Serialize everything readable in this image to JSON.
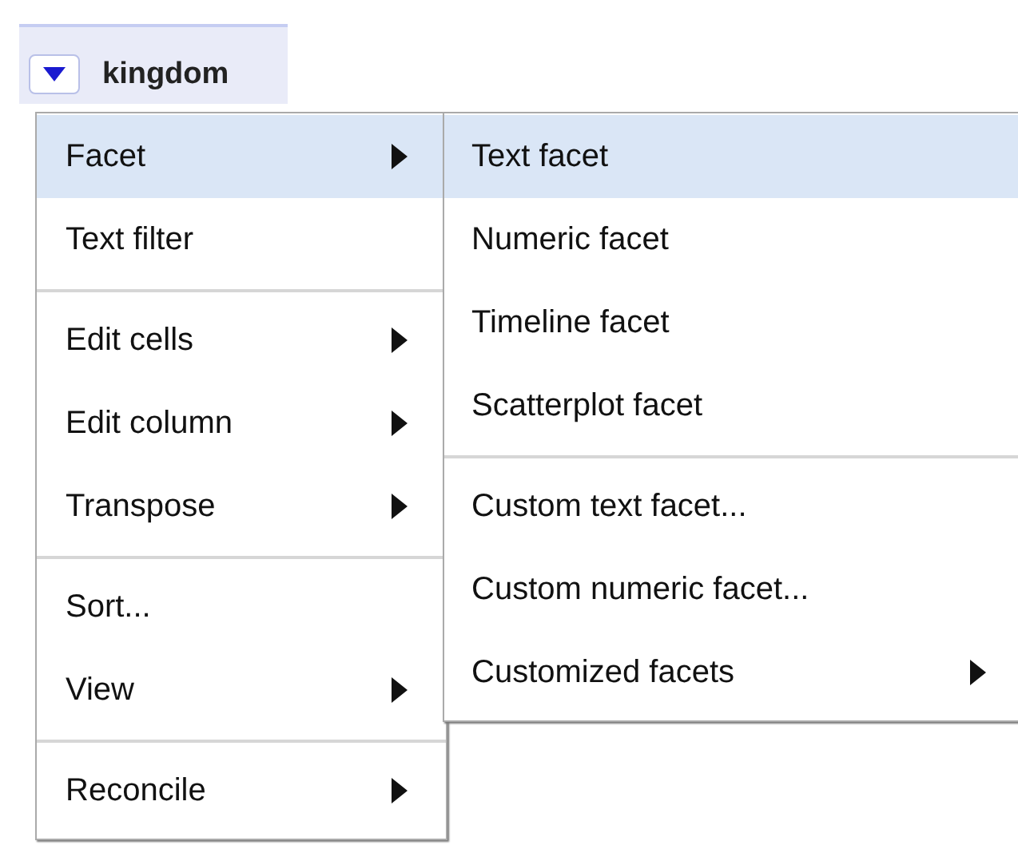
{
  "column_header": {
    "label": "kingdom"
  },
  "menu": {
    "groups": [
      [
        {
          "label": "Facet",
          "submenu": true,
          "selected": true
        },
        {
          "label": "Text filter",
          "submenu": false,
          "selected": false
        }
      ],
      [
        {
          "label": "Edit cells",
          "submenu": true,
          "selected": false
        },
        {
          "label": "Edit column",
          "submenu": true,
          "selected": false
        },
        {
          "label": "Transpose",
          "submenu": true,
          "selected": false
        }
      ],
      [
        {
          "label": "Sort...",
          "submenu": false,
          "selected": false
        },
        {
          "label": "View",
          "submenu": true,
          "selected": false
        }
      ],
      [
        {
          "label": "Reconcile",
          "submenu": true,
          "selected": false
        }
      ]
    ]
  },
  "submenu": {
    "groups": [
      [
        {
          "label": "Text facet",
          "submenu": false,
          "selected": true
        },
        {
          "label": "Numeric facet",
          "submenu": false,
          "selected": false
        },
        {
          "label": "Timeline facet",
          "submenu": false,
          "selected": false
        },
        {
          "label": "Scatterplot facet",
          "submenu": false,
          "selected": false
        }
      ],
      [
        {
          "label": "Custom text facet...",
          "submenu": false,
          "selected": false
        },
        {
          "label": "Custom numeric facet...",
          "submenu": false,
          "selected": false
        },
        {
          "label": "Customized facets",
          "submenu": true,
          "selected": false
        }
      ]
    ]
  }
}
